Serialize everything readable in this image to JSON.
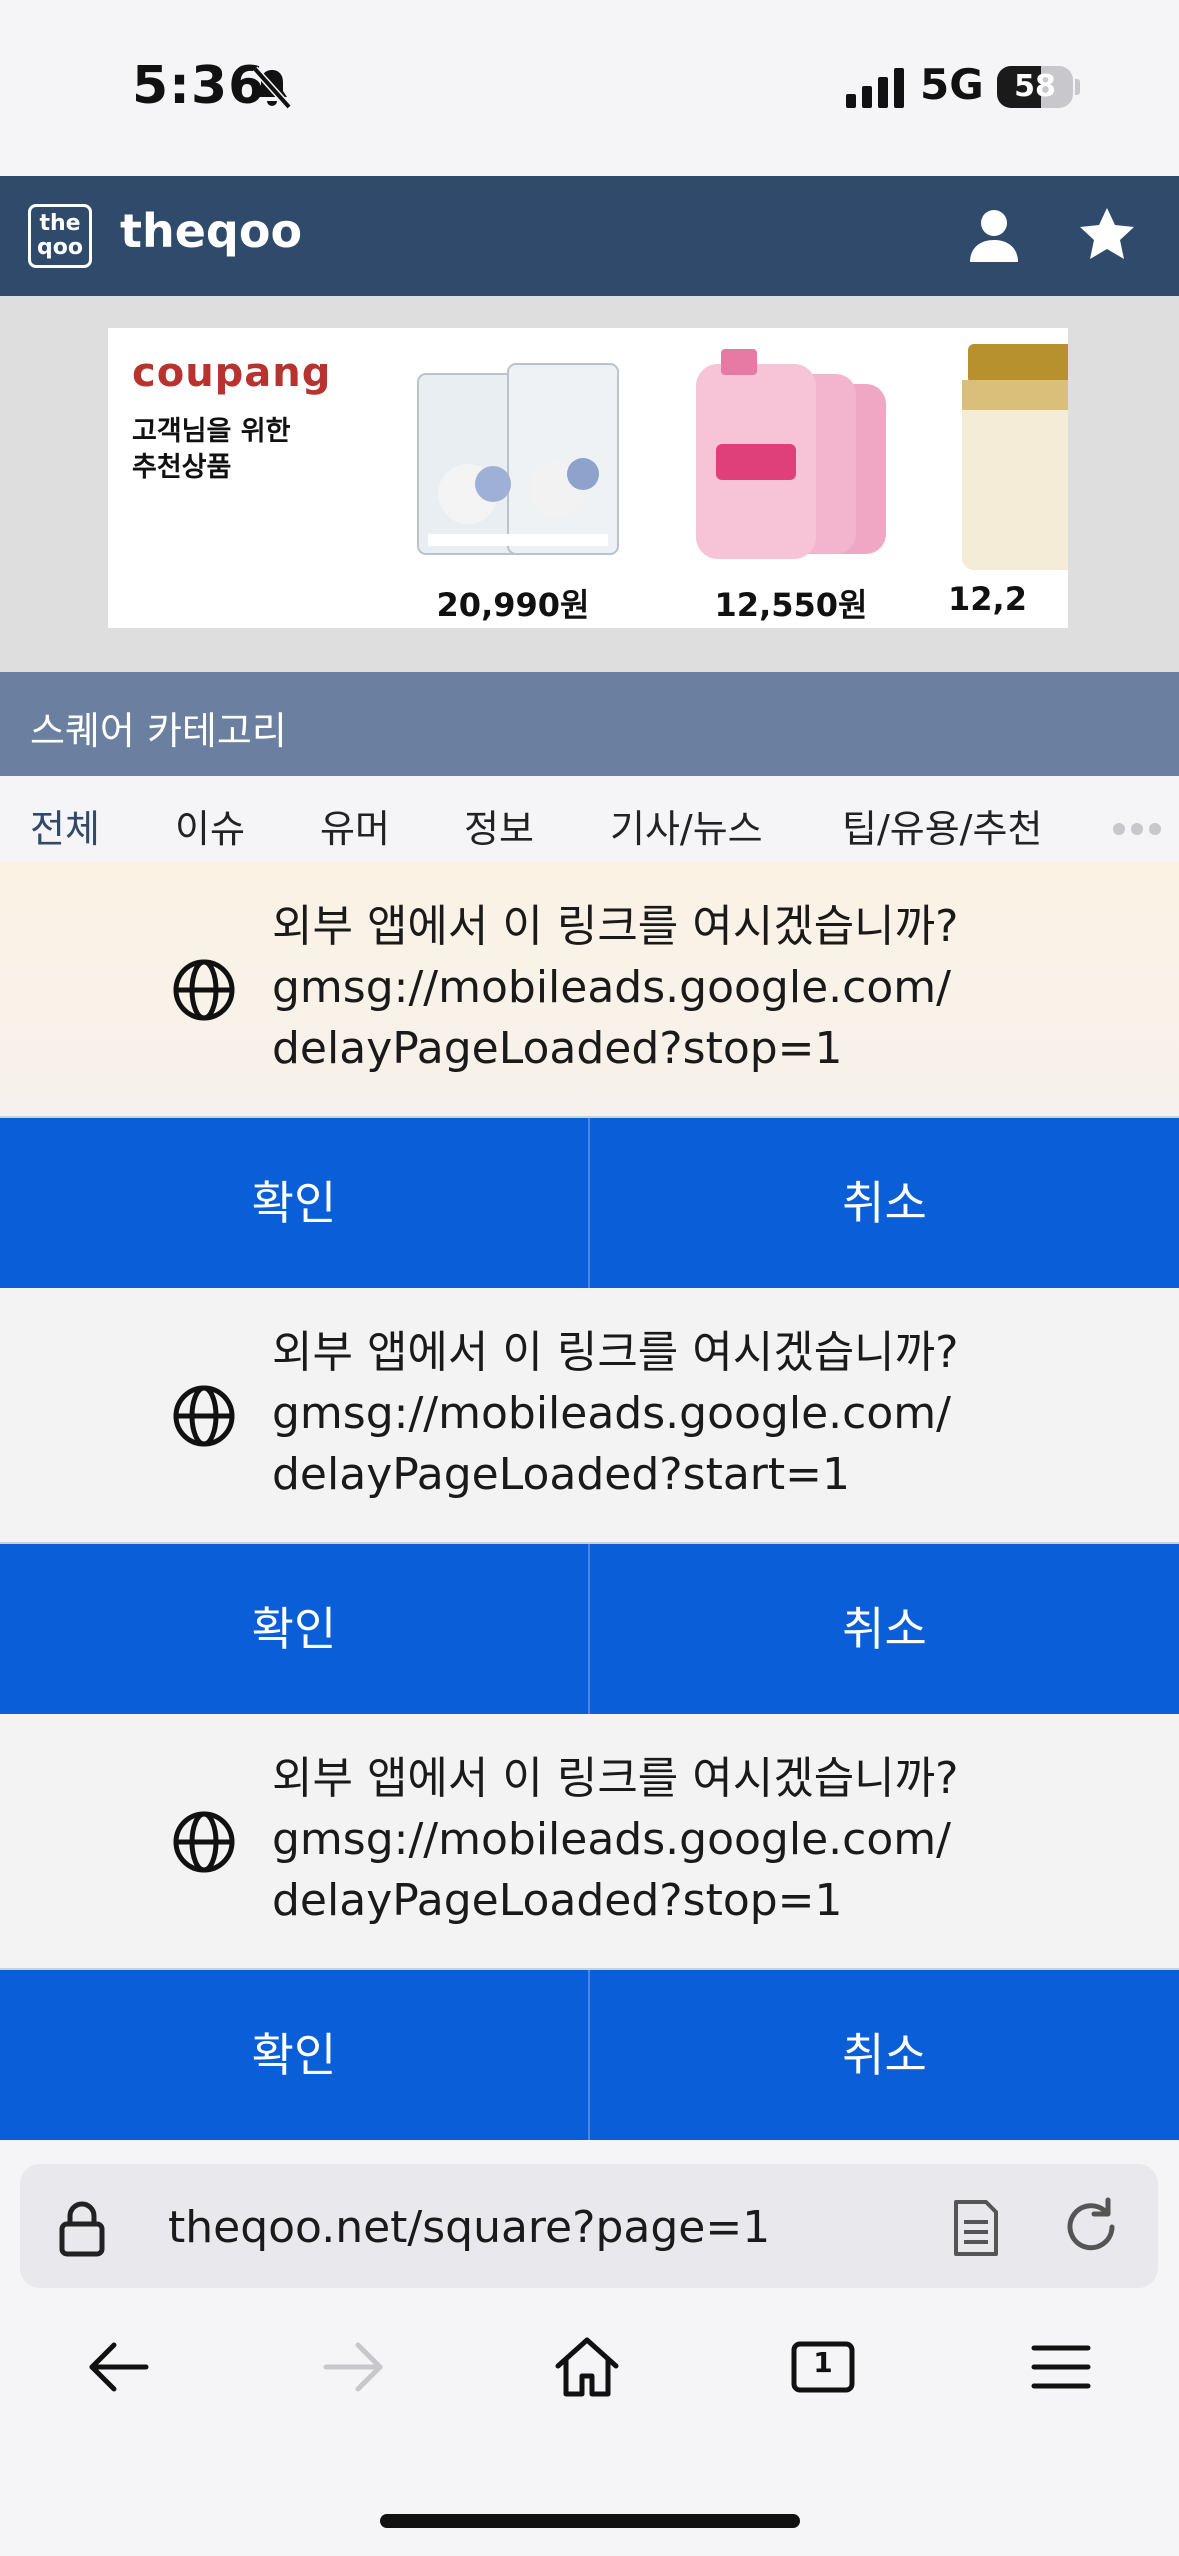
{
  "status_bar": {
    "time": "5:36",
    "network": "5G",
    "battery_level": 58,
    "battery_text": "58"
  },
  "site": {
    "title": "theqoo",
    "logo_text_line1": "the",
    "logo_text_line2": "qoo"
  },
  "ad": {
    "brand": "coupang",
    "tagline": "고객님을 위한 추천상품",
    "products": [
      {
        "price": "20,990원"
      },
      {
        "price": "12,550원"
      },
      {
        "price": "12,2"
      }
    ]
  },
  "category": {
    "title": "스퀘어 카테고리",
    "tabs": [
      "전체",
      "이슈",
      "유머",
      "정보",
      "기사/뉴스",
      "팁/유용/추천"
    ],
    "active_tab": "전체"
  },
  "dialogs": [
    {
      "line1": "외부 앱에서 이 링크를 여시겠습니까?",
      "line2": "gmsg://mobileads.google.com/",
      "line3": "delayPageLoaded?stop=1",
      "confirm": "확인",
      "cancel": "취소"
    },
    {
      "line1": "외부 앱에서 이 링크를 여시겠습니까?",
      "line2": "gmsg://mobileads.google.com/",
      "line3": "delayPageLoaded?start=1",
      "confirm": "확인",
      "cancel": "취소"
    },
    {
      "line1": "외부 앱에서 이 링크를 여시겠습니까?",
      "line2": "gmsg://mobileads.google.com/",
      "line3": "delayPageLoaded?stop=1",
      "confirm": "확인",
      "cancel": "취소"
    }
  ],
  "browser": {
    "url": "theqoo.net/square?page=1",
    "tab_count": "1"
  },
  "colors": {
    "header": "#2f4a6b",
    "category": "#6b7fa0",
    "button": "#0a5fd8"
  }
}
